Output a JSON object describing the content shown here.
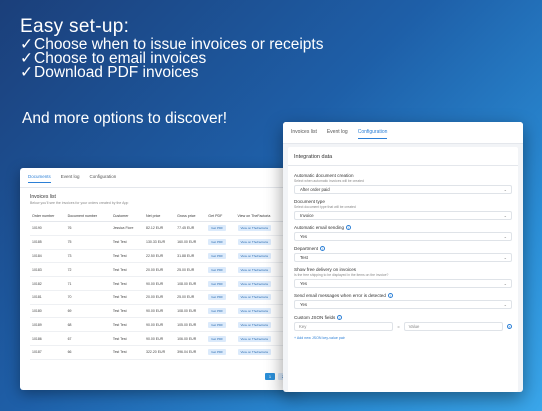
{
  "hero": {
    "title": "Easy set-up:",
    "bullets": [
      "Choose when to issue invoices or receipts",
      "Choose to email invoices",
      "Download PDF invoices"
    ],
    "more": "And more options to discover!"
  },
  "back_window": {
    "tabs": [
      "Documents",
      "Event log",
      "Configuration"
    ],
    "active_tab": "Documents",
    "title": "Invoices list",
    "subtitle": "Below you'll see the invoices for your orders created by the App",
    "columns": [
      "Order number",
      "Document number",
      "Customer",
      "Net price",
      "Gross price",
      "Get PDF",
      "View on TheFactoria"
    ],
    "rows": [
      [
        "10190",
        "76",
        "Jessica Fiore",
        "82.12 EUR",
        "77.45 EUR",
        "Get PDF",
        "View on TheFactoria"
      ],
      [
        "10185",
        "75",
        "Test Test",
        "130.33 EUR",
        "160.00 EUR",
        "Get PDF",
        "View on TheFactoria"
      ],
      [
        "10184",
        "73",
        "Test Test",
        "22.50 EUR",
        "31.88 EUR",
        "Get PDF",
        "View on TheFactoria"
      ],
      [
        "10183",
        "72",
        "Test Test",
        "20.00 EUR",
        "25.00 EUR",
        "Get PDF",
        "View on TheFactoria"
      ],
      [
        "10182",
        "71",
        "Test Test",
        "90.00 EUR",
        "108.00 EUR",
        "Get PDF",
        "View on TheFactoria"
      ],
      [
        "10181",
        "70",
        "Test Test",
        "20.00 EUR",
        "25.00 EUR",
        "Get PDF",
        "View on TheFactoria"
      ],
      [
        "10180",
        "69",
        "Test Test",
        "90.00 EUR",
        "108.00 EUR",
        "Get PDF",
        "View on TheFactoria"
      ],
      [
        "10189",
        "68",
        "Test Test",
        "90.00 EUR",
        "105.00 EUR",
        "Get PDF",
        "View on TheFactoria"
      ],
      [
        "10186",
        "67",
        "Test Test",
        "90.00 EUR",
        "106.00 EUR",
        "Get PDF",
        "View on TheFactoria"
      ],
      [
        "10187",
        "66",
        "Test Test",
        "322.20 EUR",
        "396.04 EUR",
        "Get PDF",
        "View on TheFactoria"
      ]
    ],
    "pages": [
      "1",
      "2"
    ]
  },
  "front_window": {
    "tabs": [
      "Invoices list",
      "Event log",
      "Configuration"
    ],
    "active_tab": "Configuration",
    "panel_title": "Integration data",
    "fields": [
      {
        "label": "Automatic document creation",
        "hint": "Select when automatic invoices will be created",
        "value": "After order paid",
        "info": false
      },
      {
        "label": "Document type",
        "hint": "Select document type that will be created",
        "value": "Invoice",
        "info": false
      },
      {
        "label": "Automatic email sending",
        "hint": "",
        "value": "Yes",
        "info": true
      },
      {
        "label": "Department",
        "hint": "",
        "value": "Test",
        "info": true
      },
      {
        "label": "Show free delivery on invoices",
        "hint": "Is the free shipping to be displayed in the items on the invoice?",
        "value": "Yes",
        "info": false
      },
      {
        "label": "Send email messages when error is detected",
        "hint": "",
        "value": "Yes",
        "info": true
      }
    ],
    "json_fields": {
      "label": "Custom JSON fields",
      "key_placeholder": "Key",
      "value_placeholder": "Value",
      "separator": "=",
      "add_label": "+ Add new JSON key-value pair"
    }
  }
}
